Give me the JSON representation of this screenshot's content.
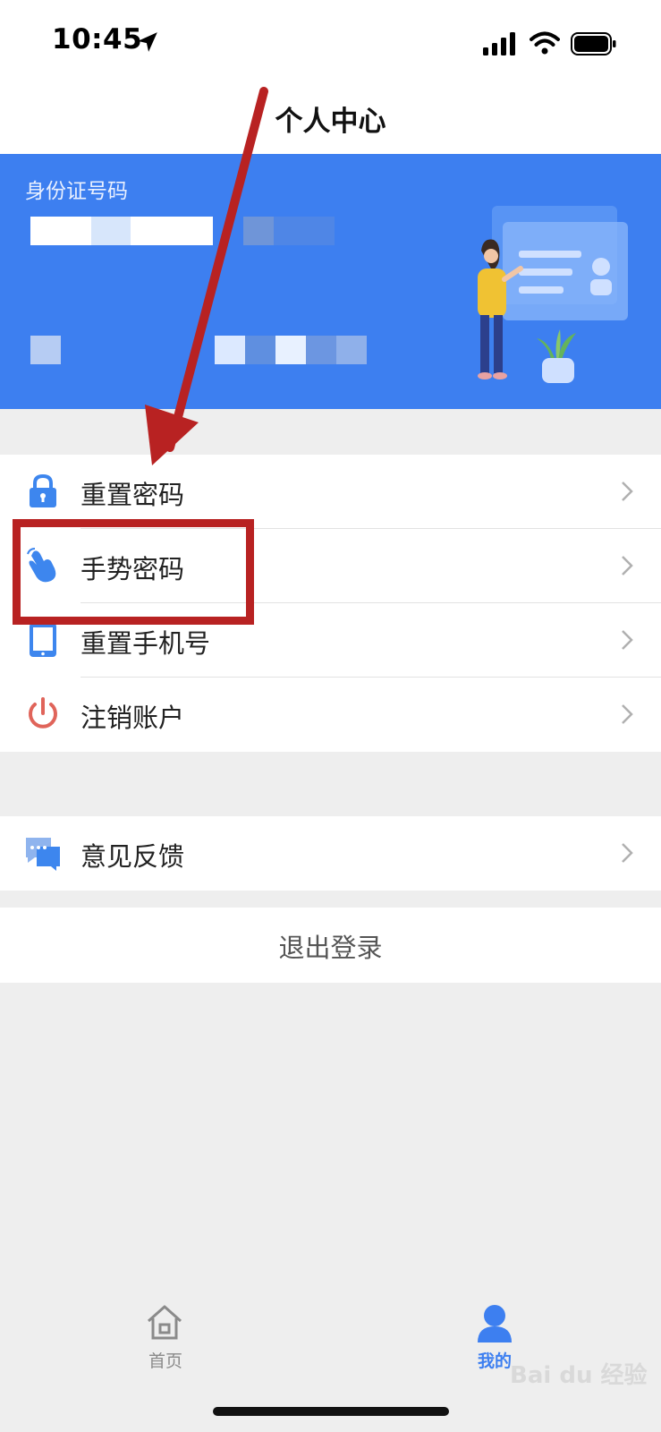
{
  "status_bar": {
    "time": "10:45",
    "location_icon": "location-arrow-icon",
    "signal_icon": "cellular-signal-icon",
    "wifi_icon": "wifi-icon",
    "battery_icon": "battery-icon"
  },
  "header": {
    "title": "个人中心"
  },
  "profile_card": {
    "id_label": "身份证号码",
    "background": "#3d7ff0",
    "illustration": "person-presenting-id-card-illustration"
  },
  "menu_group_1": [
    {
      "label": "重置密码",
      "icon": "lock-icon"
    },
    {
      "label": "手势密码",
      "icon": "hand-gesture-icon"
    },
    {
      "label": "重置手机号",
      "icon": "phone-icon"
    },
    {
      "label": "注销账户",
      "icon": "power-icon"
    }
  ],
  "menu_group_2": [
    {
      "label": "意见反馈",
      "icon": "feedback-chat-icon"
    }
  ],
  "logout": {
    "label": "退出登录"
  },
  "tabbar": {
    "items": [
      {
        "label": "首页",
        "icon": "home-icon",
        "active": false
      },
      {
        "label": "我的",
        "icon": "person-icon",
        "active": true
      }
    ]
  },
  "watermark": {
    "text": "Bai du 经验"
  },
  "colors": {
    "accent": "#3d7ff0",
    "annotation": "#b82222",
    "page_bg": "#eeeeee"
  }
}
